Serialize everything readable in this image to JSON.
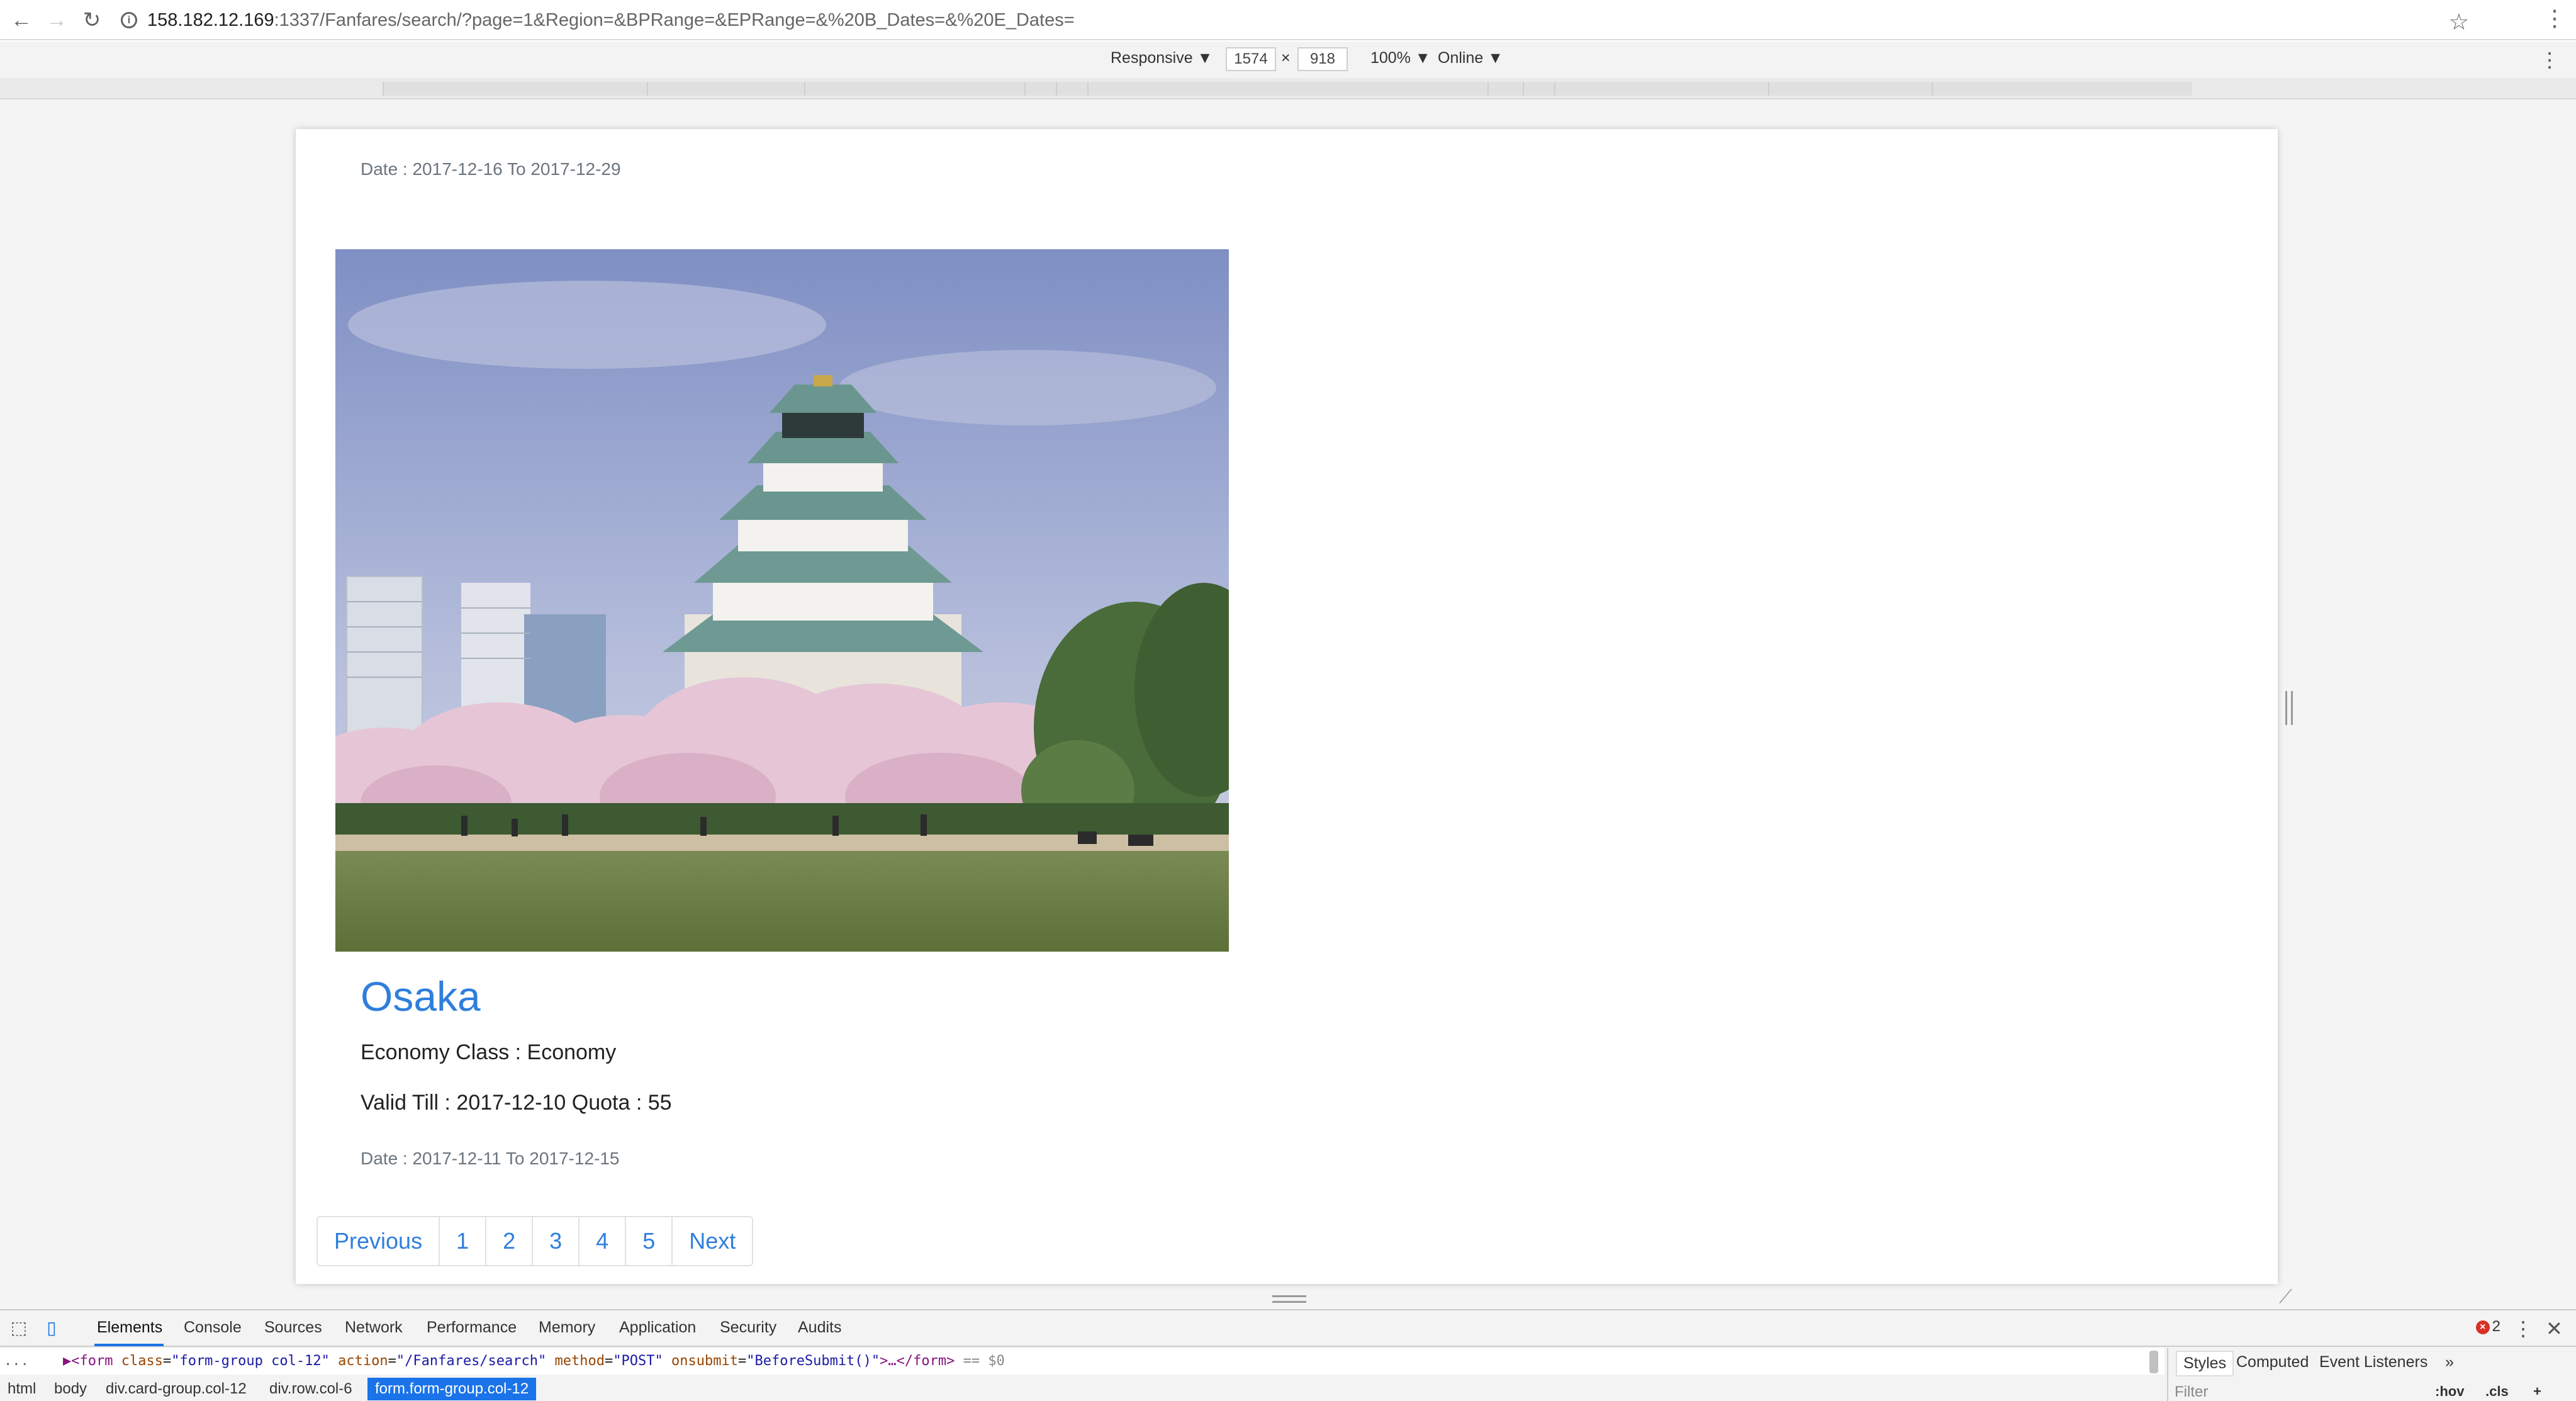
{
  "browser": {
    "url_host": "158.182.12.169",
    "url_rest": ":1337/Fanfares/search/?page=1&Region=&BPRange=&EPRange=&%20B_Dates=&%20E_Dates="
  },
  "device_toolbar": {
    "mode": "Responsive ▼",
    "width": "1574",
    "times": "×",
    "height": "918",
    "zoom": "100% ▼",
    "network": "Online ▼"
  },
  "page": {
    "prev_card_date": "Date : 2017-12-16 To 2017-12-29",
    "card": {
      "title": "Osaka",
      "economy": "Economy Class : Economy",
      "valid_quota": "Valid Till : 2017-12-10  Quota :  55",
      "date": "Date : 2017-12-11 To 2017-12-15"
    },
    "pagination": [
      "Previous",
      "1",
      "2",
      "3",
      "4",
      "5",
      "Next"
    ]
  },
  "devtools": {
    "tabs": [
      "Elements",
      "Console",
      "Sources",
      "Network",
      "Performance",
      "Memory",
      "Application",
      "Security",
      "Audits"
    ],
    "error_count": "2",
    "dom_line": {
      "ellipsis": "...",
      "open": "▶<form ",
      "class_attr": "class",
      "class_val": "\"form-group col-12\"",
      "action_attr": "action",
      "action_val": "\"/Fanfares/search\"",
      "method_attr": "method",
      "method_val": "\"POST\"",
      "onsubmit_attr": "onsubmit",
      "onsubmit_val": "\"BeforeSubmit()\"",
      "close": ">…</form>",
      "suffix": " == $0"
    },
    "breadcrumbs": [
      "html",
      "body",
      "div.card-group.col-12",
      "div.row.col-6",
      "form.form-group.col-12"
    ],
    "side_tabs": [
      "Styles",
      "Computed",
      "Event Listeners",
      "»"
    ],
    "filter_placeholder": "Filter",
    "hov": ":hov",
    "cls": ".cls",
    "plus": "+"
  }
}
